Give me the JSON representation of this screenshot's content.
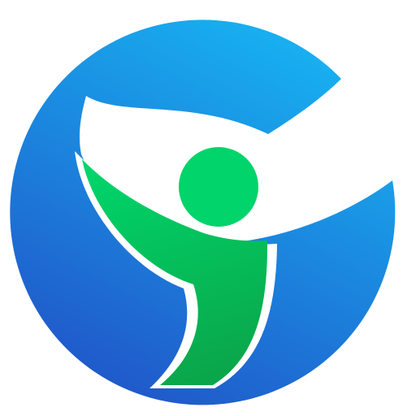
{
  "icon": {
    "name": "blue-ring-figure-logo",
    "colors": {
      "ring_light": "#17b4f2",
      "ring_dark": "#2056c9",
      "figure_light": "#00d46a",
      "figure_dark": "#0aa64a",
      "cutout": "#ffffff"
    },
    "elements": [
      "blue-crescent-ring",
      "green-figure-head",
      "green-figure-body"
    ]
  }
}
